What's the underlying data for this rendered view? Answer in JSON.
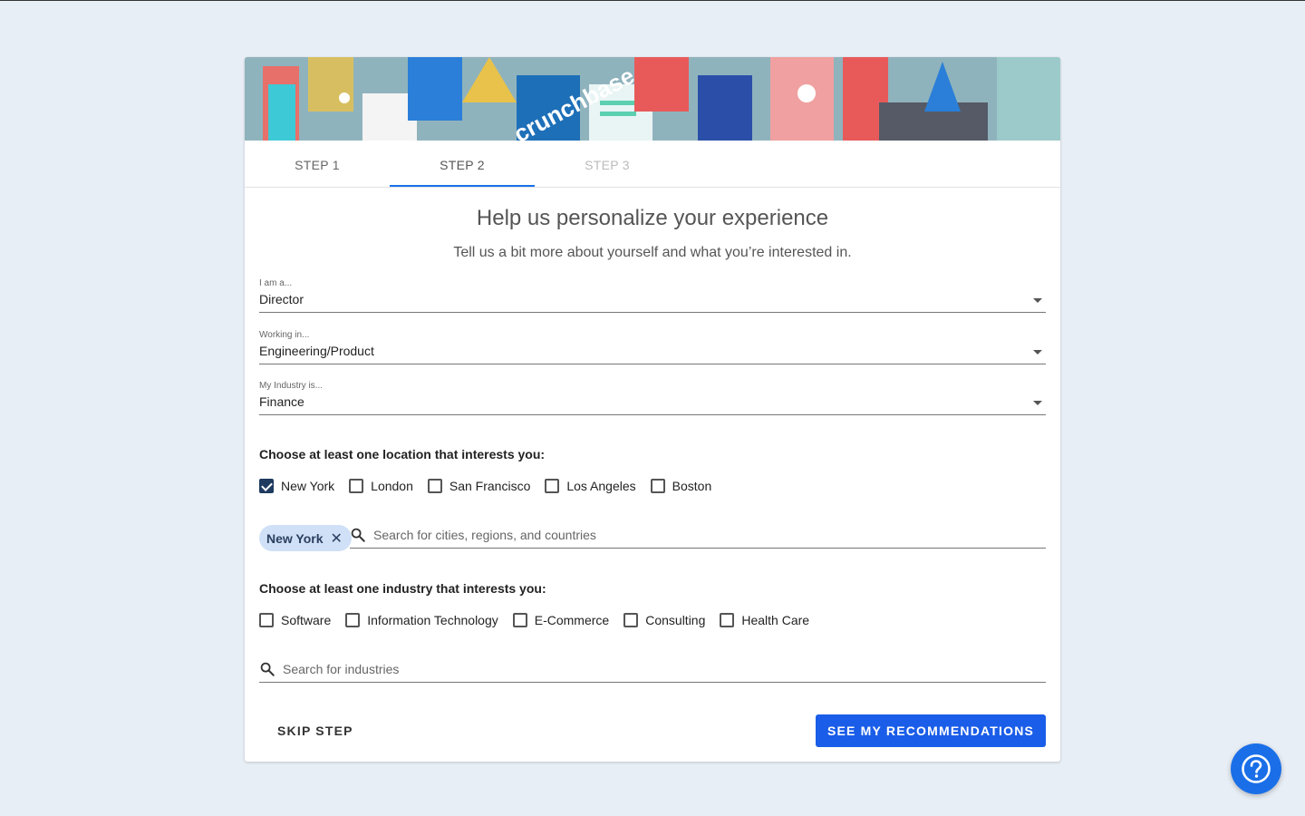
{
  "banner": {
    "brand_text": "crunchbase",
    "icon": "banner-illustration"
  },
  "tabs": [
    {
      "label": "STEP 1",
      "state": "completed"
    },
    {
      "label": "STEP 2",
      "state": "active"
    },
    {
      "label": "STEP 3",
      "state": "disabled"
    }
  ],
  "heading": "Help us personalize your experience",
  "subheading": "Tell us a bit more about yourself and what you’re interested in.",
  "fields": {
    "role": {
      "label": "I am a...",
      "value": "Director"
    },
    "department": {
      "label": "Working in...",
      "value": "Engineering/Product"
    },
    "industry": {
      "label": "My Industry is...",
      "value": "Finance"
    }
  },
  "locations": {
    "title": "Choose at least one location that interests you:",
    "options": [
      {
        "label": "New York",
        "checked": true
      },
      {
        "label": "London",
        "checked": false
      },
      {
        "label": "San Francisco",
        "checked": false
      },
      {
        "label": "Los Angeles",
        "checked": false
      },
      {
        "label": "Boston",
        "checked": false
      }
    ],
    "selected_chip": "New York",
    "chip_remove": "✕",
    "search_placeholder": "Search for cities, regions, and countries"
  },
  "industries": {
    "title": "Choose at least one industry that interests you:",
    "options": [
      {
        "label": "Software",
        "checked": false
      },
      {
        "label": "Information Technology",
        "checked": false
      },
      {
        "label": "E-Commerce",
        "checked": false
      },
      {
        "label": "Consulting",
        "checked": false
      },
      {
        "label": "Health Care",
        "checked": false
      }
    ],
    "search_placeholder": "Search for industries"
  },
  "actions": {
    "skip_label": "SKIP STEP",
    "primary_label": "SEE MY RECOMMENDATIONS"
  },
  "help": {
    "icon": "help-question-icon"
  },
  "colors": {
    "page_bg": "#e8eef5",
    "accent": "#1a5de8",
    "tab_indicator": "#1a73e8",
    "chip_bg": "#cfe0f7",
    "checked_box": "#1e3a5f",
    "help_button": "#1a6fe8"
  }
}
